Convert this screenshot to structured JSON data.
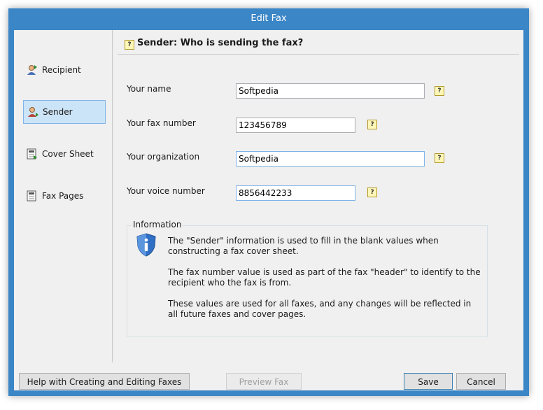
{
  "window": {
    "title": "Edit Fax"
  },
  "nav": {
    "items": [
      {
        "label": "Recipient",
        "icon": "recipient-icon"
      },
      {
        "label": "Sender",
        "icon": "sender-icon",
        "selected": true
      },
      {
        "label": "Cover Sheet",
        "icon": "cover-sheet-icon"
      },
      {
        "label": "Fax Pages",
        "icon": "fax-pages-icon"
      }
    ]
  },
  "header": {
    "title": "Sender:  Who is sending the fax?"
  },
  "form": {
    "fields": [
      {
        "label": "Your name",
        "value": "Softpedia"
      },
      {
        "label": "Your fax number",
        "value": "123456789"
      },
      {
        "label": "Your organization",
        "value": "Softpedia"
      },
      {
        "label": "Your voice number",
        "value": "8856442233"
      }
    ]
  },
  "info": {
    "title": "Information",
    "paragraphs": [
      "The \"Sender\" information is used to fill in the blank values when constructing a fax cover sheet.",
      "The fax number value is used as part of the fax \"header\" to identify to the recipient who the fax is from.",
      "These values are used for all faxes, and any changes will be reflected in all future faxes and cover pages."
    ]
  },
  "buttons": {
    "help": "Help with Creating and Editing Faxes",
    "preview": "Preview Fax",
    "save": "Save",
    "cancel": "Cancel"
  },
  "colors": {
    "titlebar": "#3b86c6",
    "selection": "#cce4f7",
    "selection_border": "#7eb4ea"
  }
}
